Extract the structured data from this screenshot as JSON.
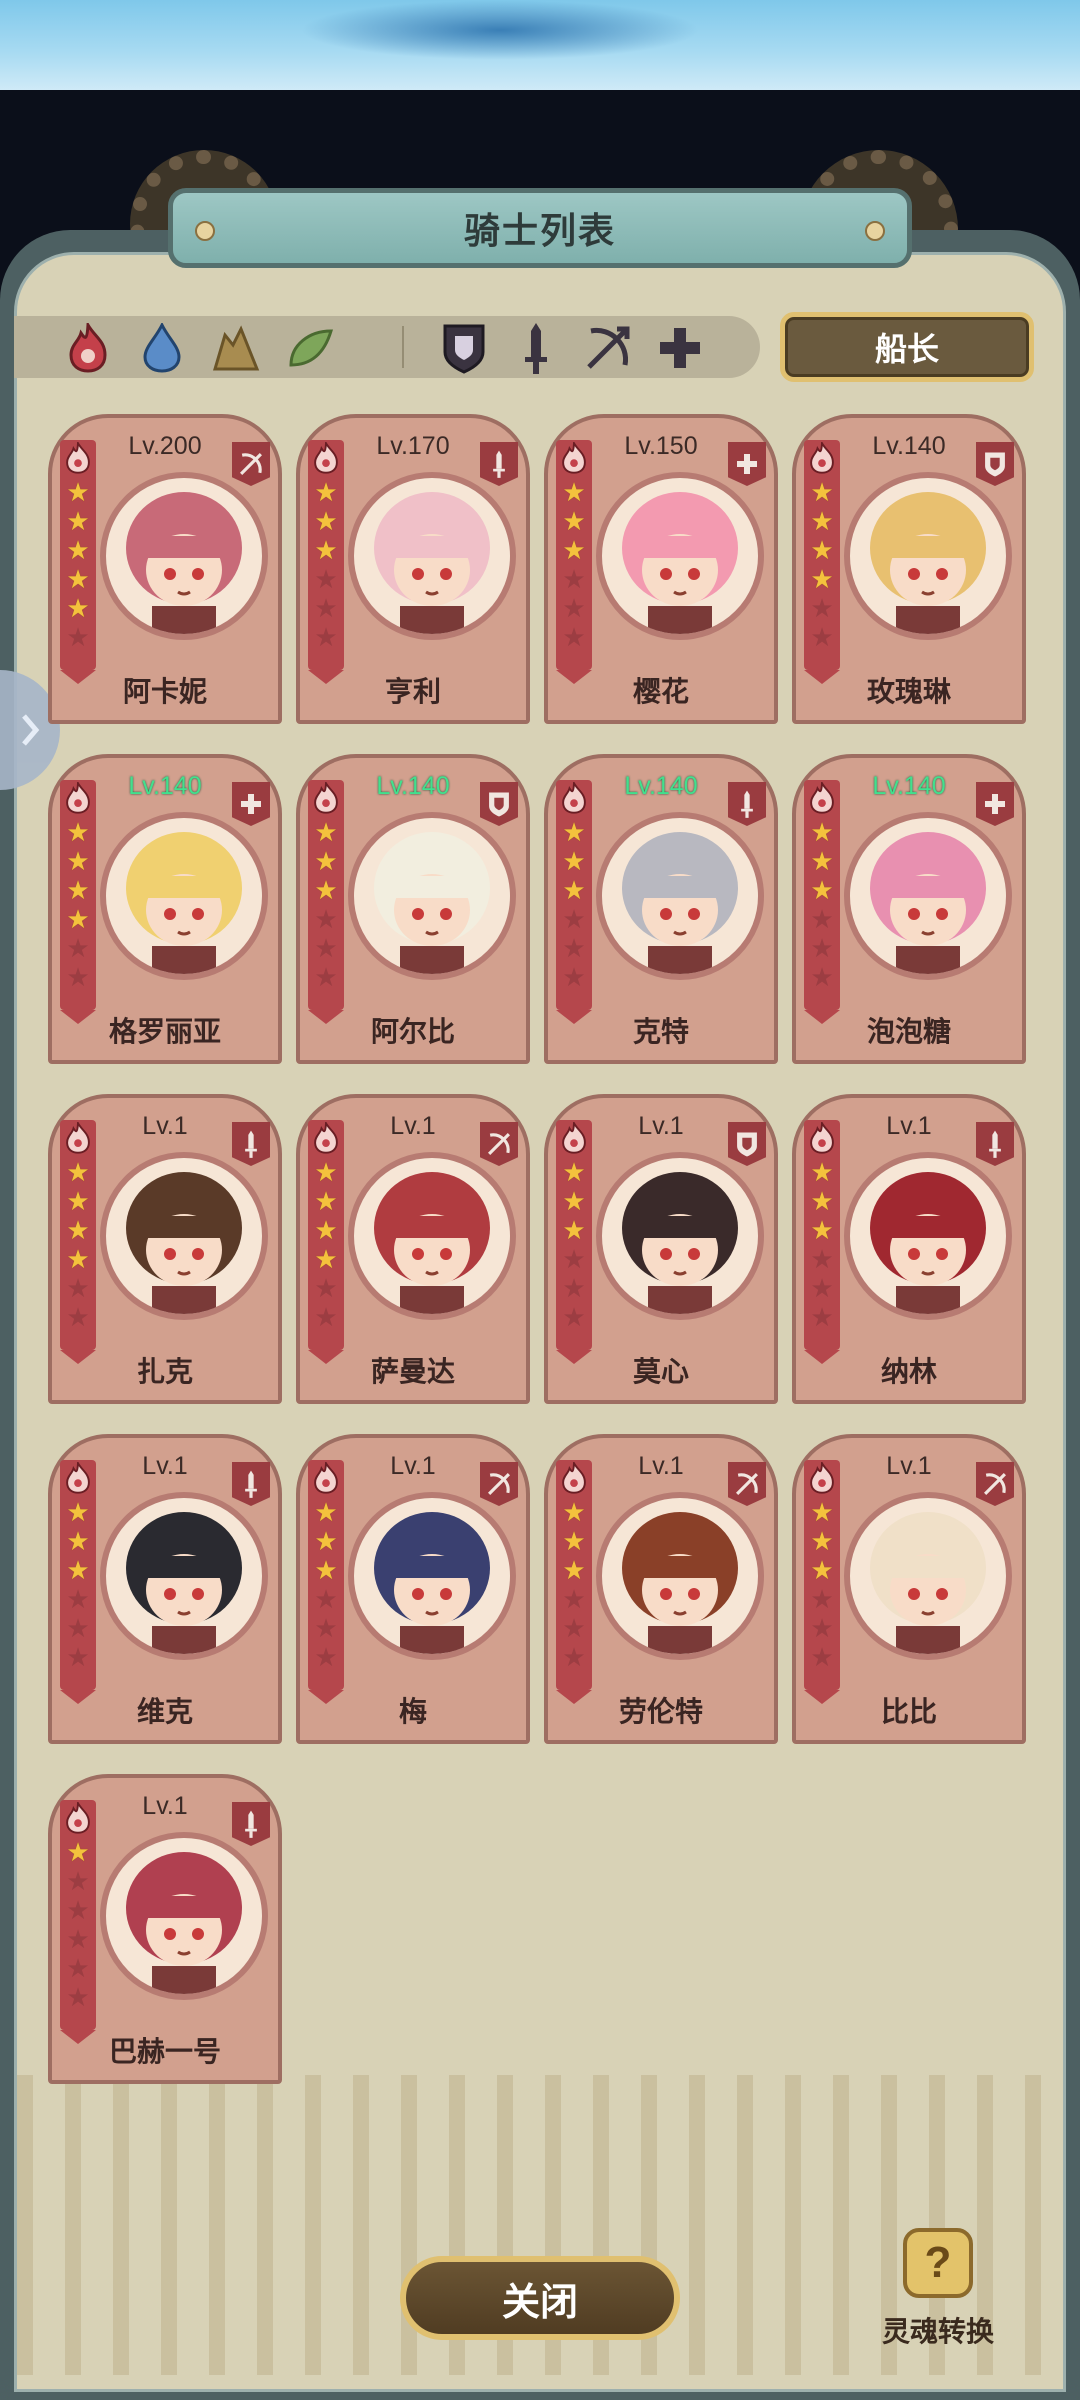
{
  "title": "骑士列表",
  "filters": {
    "elements": [
      {
        "icon": "fire-element-icon",
        "color": "#c4404a"
      },
      {
        "icon": "water-element-icon",
        "color": "#5a8cc8"
      },
      {
        "icon": "earth-element-icon",
        "color": "#a88c50"
      },
      {
        "icon": "wind-element-icon",
        "color": "#7ea65a"
      }
    ],
    "classes": [
      {
        "icon": "shield-class-icon"
      },
      {
        "icon": "sword-class-icon"
      },
      {
        "icon": "bow-class-icon"
      },
      {
        "icon": "cross-class-icon"
      }
    ]
  },
  "captain_label": "船长",
  "knights": [
    {
      "name": "阿卡妮",
      "level": "Lv.200",
      "stars": 5,
      "class": "bow-class-icon",
      "level_green": false
    },
    {
      "name": "亨利",
      "level": "Lv.170",
      "stars": 3,
      "class": "sword-class-icon",
      "level_green": false
    },
    {
      "name": "樱花",
      "level": "Lv.150",
      "stars": 3,
      "class": "cross-class-icon",
      "level_green": false
    },
    {
      "name": "玫瑰琳",
      "level": "Lv.140",
      "stars": 4,
      "class": "shield-class-icon",
      "level_green": false
    },
    {
      "name": "格罗丽亚",
      "level": "Lv.140",
      "stars": 4,
      "class": "cross-class-icon",
      "level_green": true
    },
    {
      "name": "阿尔比",
      "level": "Lv.140",
      "stars": 3,
      "class": "shield-class-icon",
      "level_green": true
    },
    {
      "name": "克特",
      "level": "Lv.140",
      "stars": 3,
      "class": "sword-class-icon",
      "level_green": true
    },
    {
      "name": "泡泡糖",
      "level": "Lv.140",
      "stars": 3,
      "class": "cross-class-icon",
      "level_green": true
    },
    {
      "name": "扎克",
      "level": "Lv.1",
      "stars": 4,
      "class": "sword-class-icon",
      "level_green": false
    },
    {
      "name": "萨曼达",
      "level": "Lv.1",
      "stars": 4,
      "class": "bow-class-icon",
      "level_green": false
    },
    {
      "name": "莫心",
      "level": "Lv.1",
      "stars": 3,
      "class": "shield-class-icon",
      "level_green": false
    },
    {
      "name": "纳林",
      "level": "Lv.1",
      "stars": 3,
      "class": "sword-class-icon",
      "level_green": false
    },
    {
      "name": "维克",
      "level": "Lv.1",
      "stars": 3,
      "class": "sword-class-icon",
      "level_green": false
    },
    {
      "name": "梅",
      "level": "Lv.1",
      "stars": 3,
      "class": "bow-class-icon",
      "level_green": false
    },
    {
      "name": "劳伦特",
      "level": "Lv.1",
      "stars": 3,
      "class": "bow-class-icon",
      "level_green": false
    },
    {
      "name": "比比",
      "level": "Lv.1",
      "stars": 3,
      "class": "bow-class-icon",
      "level_green": false
    },
    {
      "name": "巴赫一号",
      "level": "Lv.1",
      "stars": 1,
      "class": "sword-class-icon",
      "level_green": false
    }
  ],
  "close_label": "关闭",
  "soul_convert_label": "灵魂转换",
  "soul_icon_glyph": "?"
}
